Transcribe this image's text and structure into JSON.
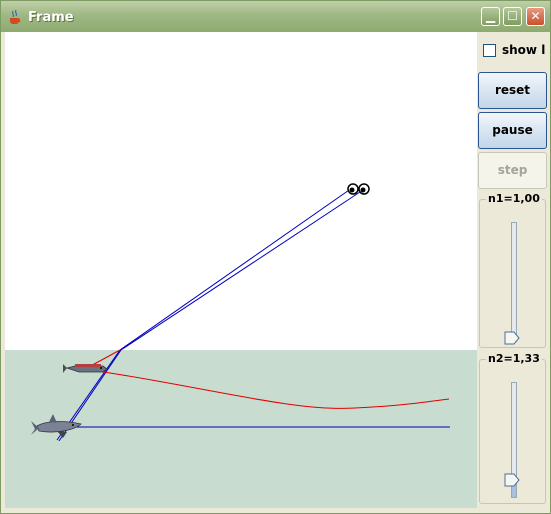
{
  "window": {
    "title": "Frame",
    "minimize_glyph": "▁",
    "maximize_glyph": "☐",
    "close_glyph": "✕"
  },
  "controls": {
    "show_label": "show l",
    "show_checked": false,
    "reset_label": "reset",
    "pause_label": "pause",
    "step_label": "step",
    "step_enabled": false
  },
  "sliders": {
    "n1": {
      "label": "n1=1,00",
      "value": 1.0
    },
    "n2": {
      "label": "n2=1,33",
      "value": 1.33
    }
  },
  "scene": {
    "air_color": "#ffffff",
    "water_color": "#c8dcd0",
    "ray_blue": "#0000c0",
    "ray_red": "#e00000",
    "icons": [
      "eyes-icon",
      "small-fish-icon",
      "shark-icon"
    ]
  }
}
